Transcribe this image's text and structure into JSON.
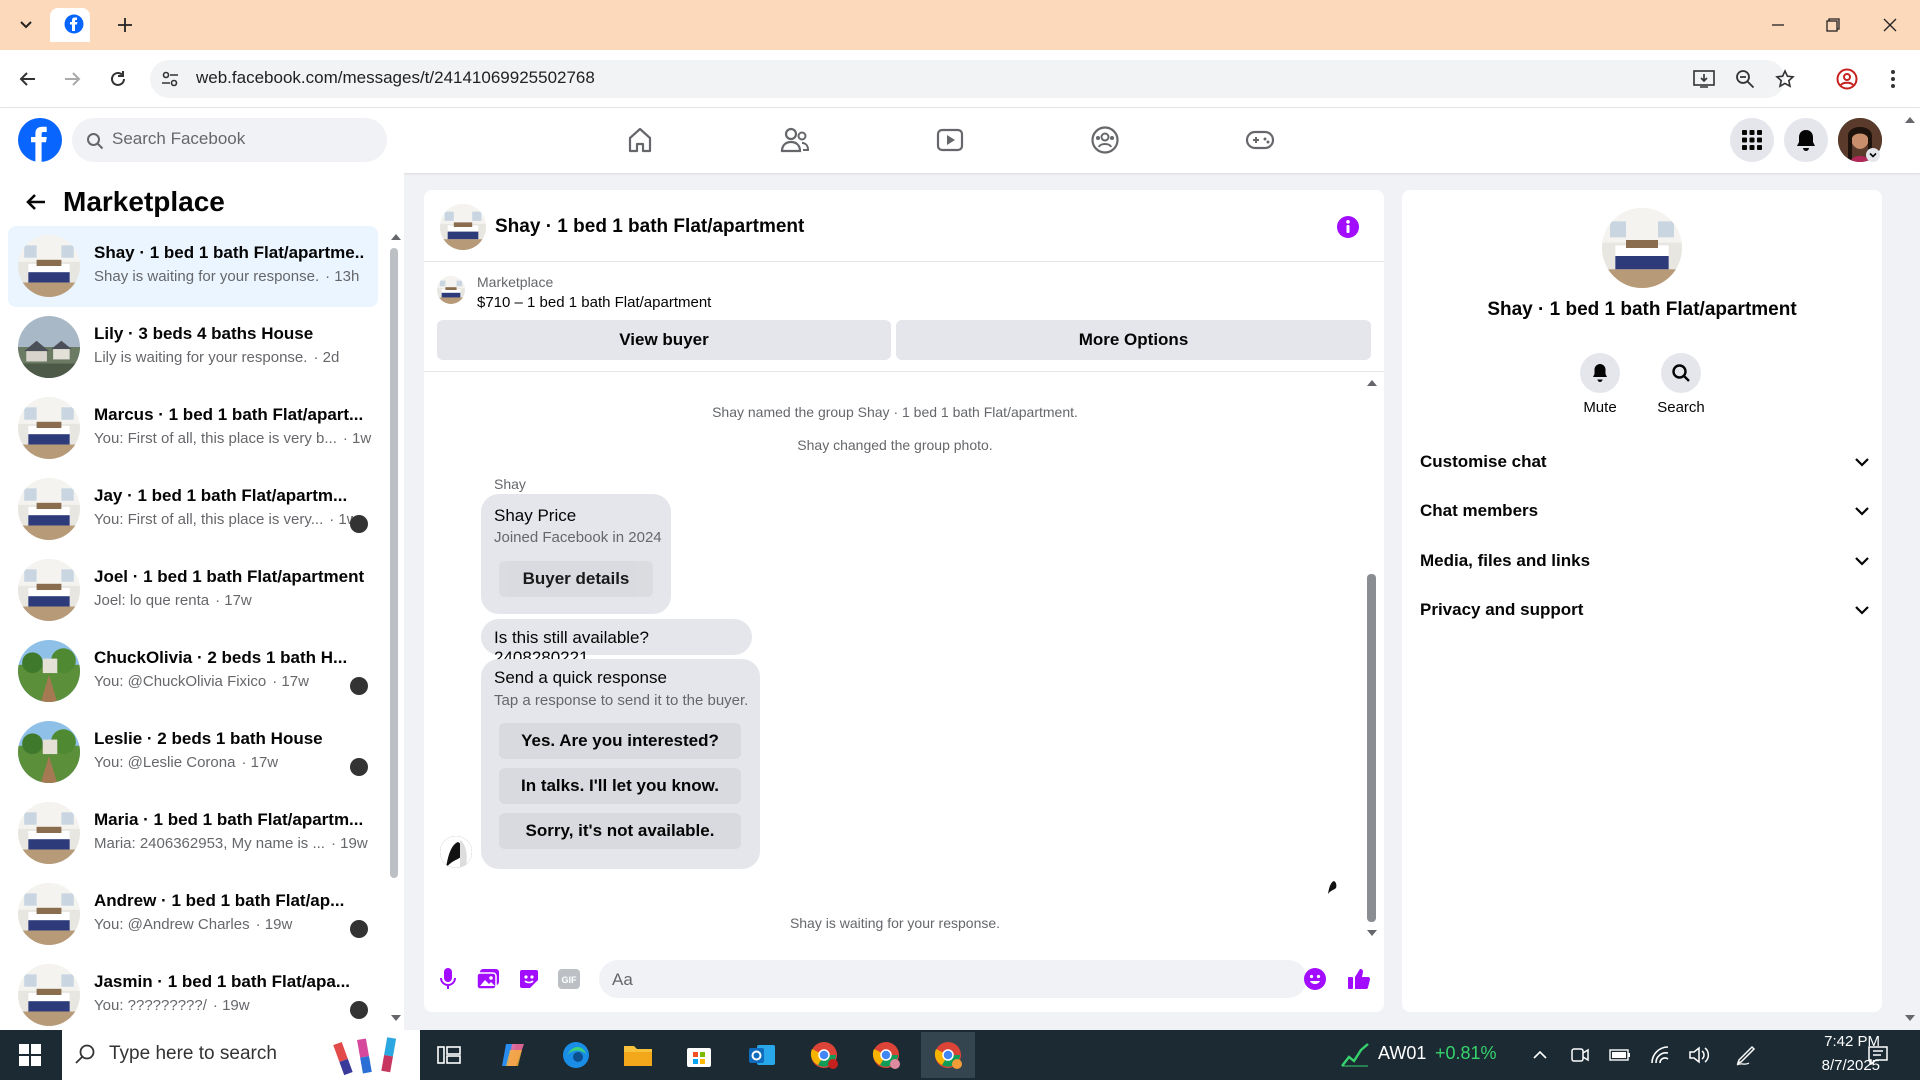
{
  "browser": {
    "url": "web.facebook.com/messages/t/24141069925502768",
    "accent": "#fcd9bb"
  },
  "facebook": {
    "search_placeholder": "Search Facebook",
    "brand_color": "#0866ff"
  },
  "sidebar": {
    "title": "Marketplace",
    "chats": [
      {
        "name": "Shay · 1 bed 1 bath Flat/apartme...",
        "preview": "Shay is waiting for your response.",
        "time": "· 13h",
        "active": true,
        "thumb": "bedroom"
      },
      {
        "name": "Lily · 3 beds 4 baths House",
        "preview": "Lily is waiting for your response.",
        "time": "· 2d",
        "thumb": "house"
      },
      {
        "name": "Marcus · 1 bed 1 bath Flat/apart...",
        "preview": "You: First of all, this place is very b...",
        "time": "· 1w",
        "thumb": "bedroom"
      },
      {
        "name": "Jay · 1 bed 1 bath Flat/apartm...",
        "preview": "You: First of all, this place is very...",
        "time": "· 1w",
        "thumb": "bedroom",
        "read": true
      },
      {
        "name": "Joel · 1 bed 1 bath Flat/apartment",
        "preview": "Joel: lo que renta",
        "time": "· 17w",
        "thumb": "bedroom"
      },
      {
        "name": "ChuckOlivia · 2 beds 1 bath H...",
        "preview": "You: @ChuckOlivia Fixico",
        "time": "· 17w",
        "thumb": "garden",
        "read": true
      },
      {
        "name": "Leslie · 2 beds 1 bath House",
        "preview": "You: @Leslie Corona",
        "time": "· 17w",
        "thumb": "garden",
        "read": true
      },
      {
        "name": "Maria · 1 bed 1 bath Flat/apartm...",
        "preview": "Maria: 2406362953, My name is ...",
        "time": "· 19w",
        "thumb": "bedroom"
      },
      {
        "name": "Andrew · 1 bed 1 bath Flat/ap...",
        "preview": "You: @Andrew Charles",
        "time": "· 19w",
        "thumb": "bedroom",
        "read": true
      },
      {
        "name": "Jasmin · 1 bed 1 bath Flat/apa...",
        "preview": "You: ?????????/",
        "time": "· 19w",
        "thumb": "bedroom",
        "read": true
      }
    ]
  },
  "chat": {
    "title": "Shay · 1 bed 1 bath Flat/apartment",
    "listing_label": "Marketplace",
    "listing_price": "$710 – 1 bed 1 bath Flat/apartment",
    "view_buyer": "View buyer",
    "more_options": "More Options",
    "system_1": "Shay named the group Shay · 1 bed 1 bath Flat/apartment.",
    "system_2": "Shay changed the group photo.",
    "sender": "Shay",
    "card_name": "Shay Price",
    "card_sub": "Joined Facebook in 2024",
    "buyer_details": "Buyer details",
    "message": "Is this still available? 2408280221",
    "quick_title": "Send a quick response",
    "quick_sub": "Tap a response to send it to the buyer.",
    "quick_1": "Yes. Are you interested?",
    "quick_2": "In talks. I'll let you know.",
    "quick_3": "Sorry, it's not available.",
    "waiting": "Shay is waiting for your response.",
    "composer_placeholder": "Aa",
    "accent": "#a20dff",
    "messenger_blue": "#0866ff"
  },
  "info": {
    "title": "Shay · 1 bed 1 bath Flat/apartment",
    "mute": "Mute",
    "search": "Search",
    "sections": [
      "Customise chat",
      "Chat members",
      "Media, files and links",
      "Privacy and support"
    ]
  },
  "taskbar": {
    "search_placeholder": "Type here to search",
    "stock_name": "AW01",
    "stock_change": "+0.81%",
    "time": "7:42 PM",
    "date": "8/7/2025"
  }
}
